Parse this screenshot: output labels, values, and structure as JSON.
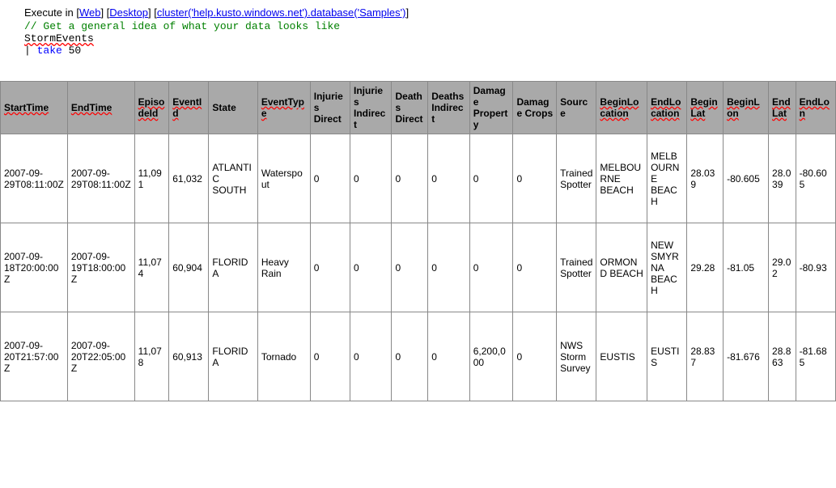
{
  "header": {
    "prefix": "Execute in [",
    "web": "Web",
    "sep1": "] [",
    "desktop": "Desktop",
    "sep2": "] [",
    "cluster": "cluster('help.kusto.windows.net').database('Samples')",
    "suffix": "]"
  },
  "code": {
    "comment": "// Get a general idea of what your data looks like",
    "table_name": "StormEvents",
    "pipe": "| ",
    "keyword": "take",
    "number": " 50"
  },
  "columns": {
    "StartTime": "StartTime",
    "EndTime": "EndTime",
    "EpisodeId": "EpisodeId",
    "EventId": "EventId",
    "State": "State",
    "EventType": "EventType",
    "InjuriesDirect": "Injuries Direct",
    "InjuriesIndirect": "Injuries Indirect",
    "DeathsDirect": "Deaths Direct",
    "DeathsIndirect": "Deaths Indirect",
    "DamageProperty": "Damage Property",
    "DamageCrops": "Damage Crops",
    "Source": "Source",
    "BeginLocation": "BeginLocation",
    "EndLocation": "EndLocation",
    "BeginLat": "BeginLat",
    "BeginLon": "BeginLon",
    "EndLat": "EndLat",
    "EndLon": "EndLon"
  },
  "rows": [
    {
      "StartTime": "2007-09-29T08:11:00Z",
      "EndTime": "2007-09-29T08:11:00Z",
      "EpisodeId": "11,091",
      "EventId": "61,032",
      "State": "ATLANTIC SOUTH",
      "EventType": "Waterspout",
      "InjuriesDirect": "0",
      "InjuriesIndirect": "0",
      "DeathsDirect": "0",
      "DeathsIndirect": "0",
      "DamageProperty": "0",
      "DamageCrops": "0",
      "Source": "Trained Spotter",
      "BeginLocation": "MELBOURNE BEACH",
      "EndLocation": "MELBOURNE BEACH",
      "BeginLat": "28.039",
      "BeginLon": "-80.605",
      "EndLat": "28.039",
      "EndLon": "-80.605"
    },
    {
      "StartTime": "2007-09-18T20:00:00Z",
      "EndTime": "2007-09-19T18:00:00Z",
      "EpisodeId": "11,074",
      "EventId": "60,904",
      "State": "FLORIDA",
      "EventType": "Heavy Rain",
      "InjuriesDirect": "0",
      "InjuriesIndirect": "0",
      "DeathsDirect": "0",
      "DeathsIndirect": "0",
      "DamageProperty": "0",
      "DamageCrops": "0",
      "Source": "Trained Spotter",
      "BeginLocation": "ORMOND BEACH",
      "EndLocation": "NEW SMYRNA BEACH",
      "BeginLat": "29.28",
      "BeginLon": "-81.05",
      "EndLat": "29.02",
      "EndLon": "-80.93"
    },
    {
      "StartTime": "2007-09-20T21:57:00Z",
      "EndTime": "2007-09-20T22:05:00Z",
      "EpisodeId": "11,078",
      "EventId": "60,913",
      "State": "FLORIDA",
      "EventType": "Tornado",
      "InjuriesDirect": "0",
      "InjuriesIndirect": "0",
      "DeathsDirect": "0",
      "DeathsIndirect": "0",
      "DamageProperty": "6,200,000",
      "DamageCrops": "0",
      "Source": "NWS Storm Survey",
      "BeginLocation": "EUSTIS",
      "EndLocation": "EUSTIS",
      "BeginLat": "28.837",
      "BeginLon": "-81.676",
      "EndLat": "28.863",
      "EndLon": "-81.685"
    }
  ]
}
